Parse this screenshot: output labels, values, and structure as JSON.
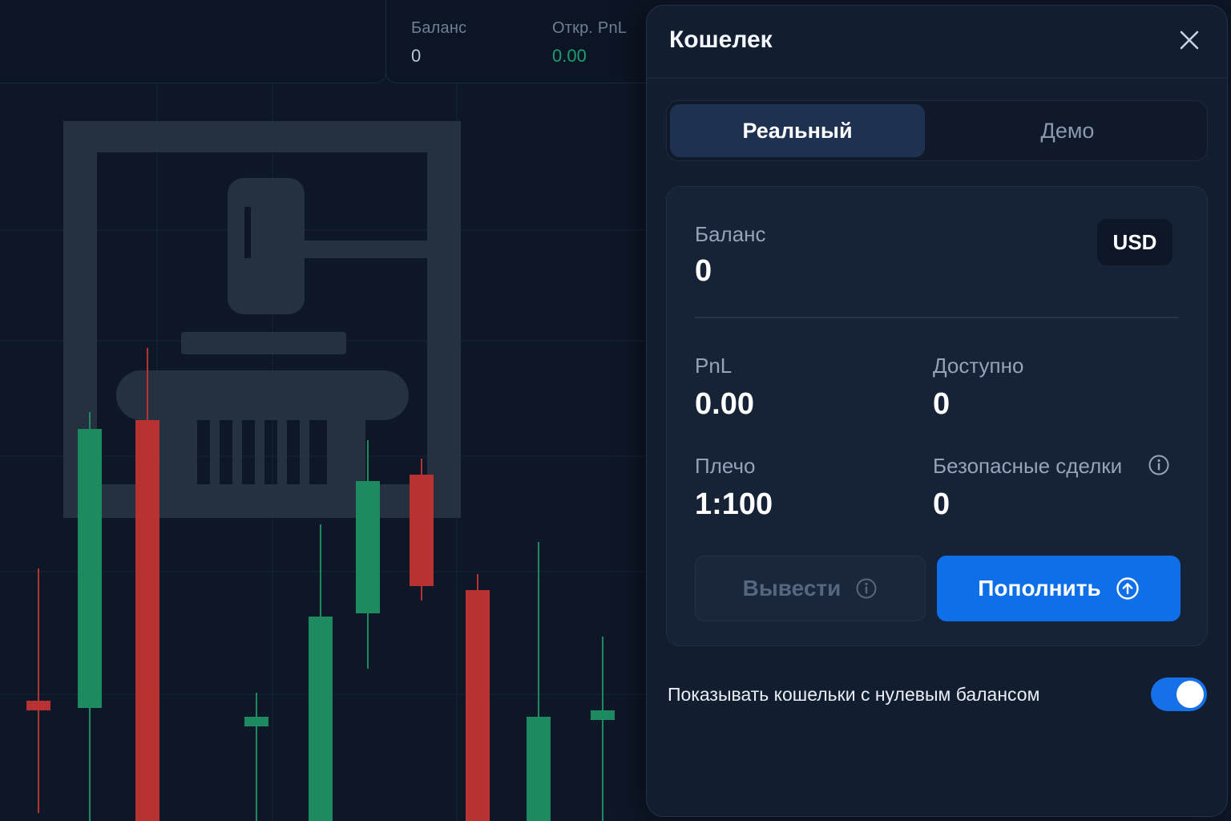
{
  "top_stats": {
    "balance_label": "Баланс",
    "balance_value": "0",
    "open_pnl_label": "Откр. PnL",
    "open_pnl_value": "0.00"
  },
  "wallet": {
    "title": "Кошелек",
    "tabs": [
      {
        "label": "Реальный",
        "active": true
      },
      {
        "label": "Демо",
        "active": false
      }
    ],
    "currency": "USD",
    "balance_label": "Баланс",
    "balance_value": "0",
    "pnl_label": "PnL",
    "pnl_value": "0.00",
    "available_label": "Доступно",
    "available_value": "0",
    "leverage_label": "Плечо",
    "leverage_value": "1:100",
    "safe_trades_label": "Безопасные сделки",
    "safe_trades_value": "0",
    "withdraw_label": "Вывести",
    "deposit_label": "Пополнить",
    "show_zero_label": "Показывать кошельки с нулевым балансом",
    "show_zero_enabled": true
  },
  "colors": {
    "accent": "#0f6fe8",
    "up_candle": "#1e8a5f",
    "down_candle": "#b83232",
    "panel_bg": "#121d2f"
  },
  "icons": {
    "close": "close-icon",
    "info": "info-icon",
    "deposit": "arrow-up-circle-icon",
    "watermark": "gavel-courthouse-icon"
  },
  "chart_data": {
    "type": "candlestick",
    "candles": [
      {
        "open": 150,
        "close": 141,
        "high": 315,
        "low": 10
      },
      {
        "open": 141,
        "close": 489,
        "high": 510,
        "low": 0
      },
      {
        "open": 500,
        "close": 0,
        "high": 590,
        "low": 0
      },
      {
        "open": 130,
        "close": 130,
        "high": 160,
        "low": 0
      },
      {
        "open": 0,
        "close": 255,
        "high": 370,
        "low": 0
      },
      {
        "open": 259,
        "close": 424,
        "high": 475,
        "low": 190
      },
      {
        "open": 432,
        "close": 293,
        "high": 452,
        "low": 275
      },
      {
        "open": 288,
        "close": 0,
        "high": 308,
        "low": 0
      },
      {
        "open": 0,
        "close": 130,
        "high": 348,
        "low": 0
      },
      {
        "open": 138,
        "close": 138,
        "high": 230,
        "low": 0
      }
    ]
  }
}
